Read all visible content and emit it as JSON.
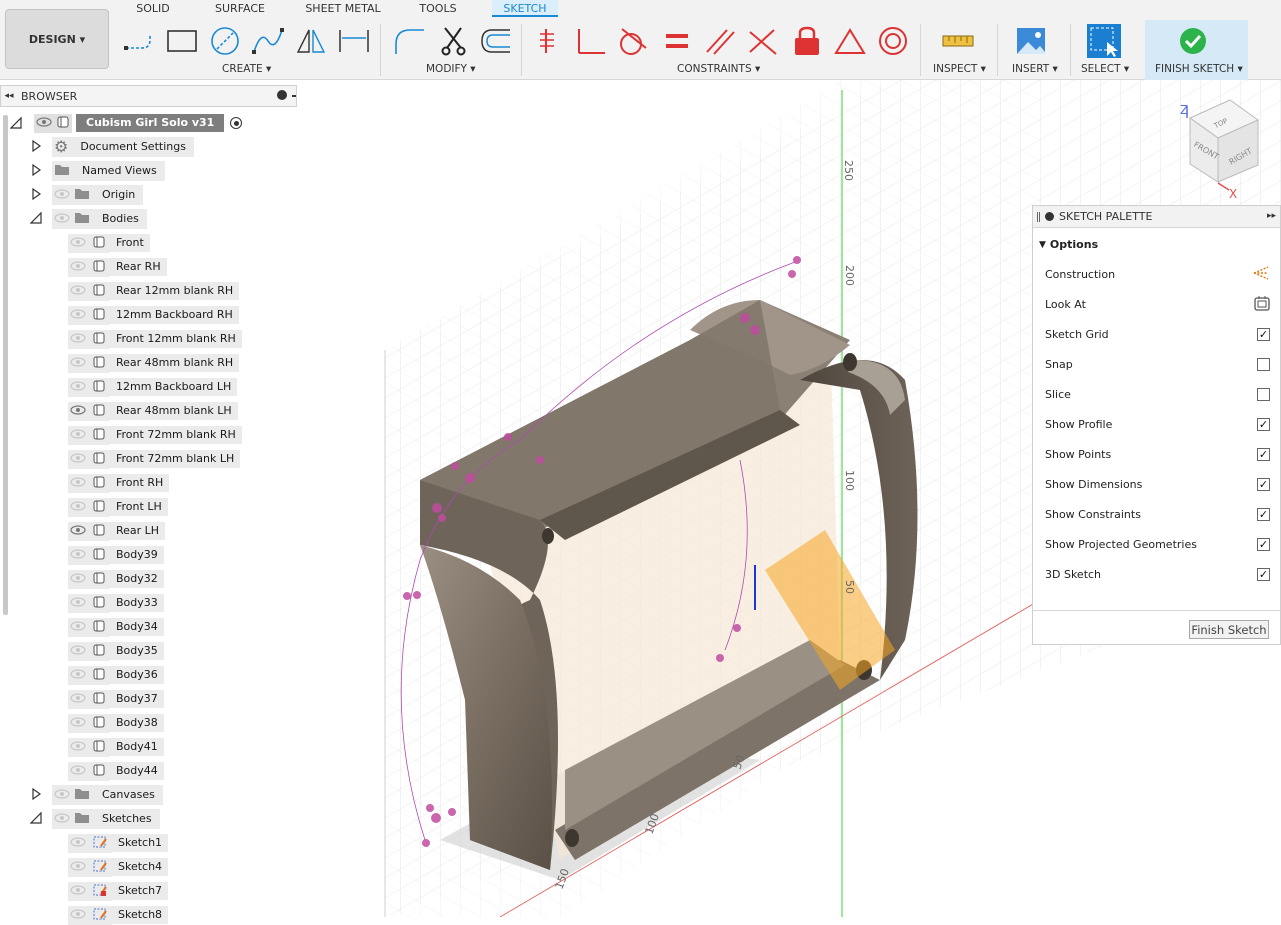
{
  "toolbar": {
    "design_label": "DESIGN ▾",
    "tabs": [
      "SOLID",
      "SURFACE",
      "SHEET METAL",
      "TOOLS",
      "SKETCH"
    ],
    "groups": [
      "CREATE ▾",
      "MODIFY ▾",
      "CONSTRAINTS ▾",
      "INSPECT ▾",
      "INSERT ▾",
      "SELECT ▾",
      "FINISH SKETCH ▾"
    ]
  },
  "browser": {
    "title": "BROWSER",
    "root": "Cubism Girl Solo v31",
    "items": [
      "Document Settings",
      "Named Views",
      "Origin",
      "Bodies"
    ],
    "bodies": [
      "Front",
      "Rear RH",
      "Rear 12mm blank RH",
      "12mm Backboard RH",
      "Front 12mm blank RH",
      "Rear 48mm blank RH",
      "12mm Backboard LH",
      "Rear 48mm blank LH",
      "Front  72mm blank RH",
      "Front  72mm blank LH",
      "Front RH",
      "Front LH",
      "Rear LH",
      "Body39",
      "Body32",
      "Body33",
      "Body34",
      "Body35",
      "Body36",
      "Body37",
      "Body38",
      "Body41",
      "Body44"
    ],
    "folders2": [
      "Canvases",
      "Sketches"
    ],
    "sketches": [
      "Sketch1",
      "Sketch4",
      "Sketch7",
      "Sketch8"
    ]
  },
  "viewcube": {
    "top": "TOP",
    "front": "FRONT",
    "right": "RIGHT",
    "z": "Z",
    "x": "X"
  },
  "axis_ticks": {
    "v250": "250",
    "v200": "200",
    "v100": "100",
    "v50": "50",
    "h50": "50",
    "h100": "100",
    "h150": "150"
  },
  "palette": {
    "title": "SKETCH PALETTE",
    "section": "Options",
    "options": [
      {
        "label": "Construction",
        "checked": null
      },
      {
        "label": "Look At",
        "checked": null
      },
      {
        "label": "Sketch Grid",
        "checked": true
      },
      {
        "label": "Snap",
        "checked": false
      },
      {
        "label": "Slice",
        "checked": false
      },
      {
        "label": "Show Profile",
        "checked": true
      },
      {
        "label": "Show Points",
        "checked": true
      },
      {
        "label": "Show Dimensions",
        "checked": true
      },
      {
        "label": "Show Constraints",
        "checked": true
      },
      {
        "label": "Show Projected Geometries",
        "checked": true
      },
      {
        "label": "3D Sketch",
        "checked": true
      }
    ],
    "finish_button": "Finish Sketch"
  }
}
